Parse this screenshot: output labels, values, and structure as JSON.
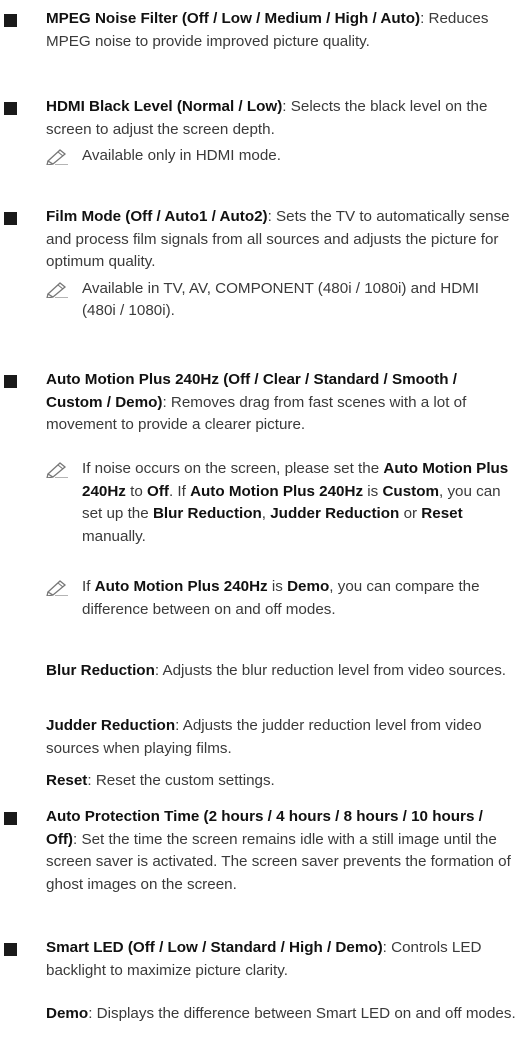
{
  "items": [
    {
      "title": "MPEG Noise Filter (Off / Low / Medium / High / Auto)",
      "desc": ": Reduces MPEG noise to provide improved picture quality."
    },
    {
      "title": "HDMI Black Level (Normal / Low)",
      "desc": ": Selects the black level on the screen to adjust the screen depth.",
      "note": "Available only in HDMI mode."
    },
    {
      "title": "Film Mode (Off / Auto1 / Auto2)",
      "desc": ": Sets the TV to automatically sense and process film signals from all sources and adjusts the picture for optimum quality.",
      "note": "Available in TV, AV, COMPONENT (480i / 1080i) and HDMI (480i / 1080i)."
    },
    {
      "title": "Auto Motion Plus 240Hz (Off / Clear / Standard / Smooth / Custom / Demo)",
      "desc": ": Removes drag from fast scenes with a lot of movement to provide a clearer picture.",
      "note1": {
        "t1": "If noise occurs on the screen, please set the ",
        "k1": "Auto Motion Plus 240Hz",
        "t2": " to ",
        "k2": "Off",
        "t3": ". If ",
        "k3": "Auto Motion Plus 240Hz",
        "t4": " is ",
        "k4": "Custom",
        "t5": ", you can set up the ",
        "k5": "Blur Reduction",
        "t6": ", ",
        "k6": "Judder Reduction",
        "t7": " or ",
        "k7": "Reset",
        "t8": " manually."
      },
      "note2": {
        "t1": "If ",
        "k1": "Auto Motion Plus 240Hz",
        "t2": " is ",
        "k2": "Demo",
        "t3": ", you can compare the difference between on and off modes."
      },
      "subitems": [
        {
          "label": "Blur Reduction",
          "desc": ": Adjusts the blur reduction level from video sources."
        },
        {
          "label": "Judder Reduction",
          "desc": ": Adjusts the judder reduction level from video sources when playing films."
        },
        {
          "label": "Reset",
          "desc": ": Reset the custom settings."
        }
      ]
    },
    {
      "title": "Auto Protection Time (2 hours / 4 hours / 8 hours / 10 hours / Off)",
      "desc": ": Set the time the screen remains idle with a still image until the screen saver is activated. The screen saver prevents the formation of ghost images on the screen."
    },
    {
      "title": "Smart LED (Off / Low / Standard / High / Demo)",
      "desc": ": Controls LED backlight to maximize picture clarity.",
      "subitems": [
        {
          "label": "Demo",
          "desc": ": Displays the difference between Smart LED on and off modes."
        }
      ]
    }
  ]
}
